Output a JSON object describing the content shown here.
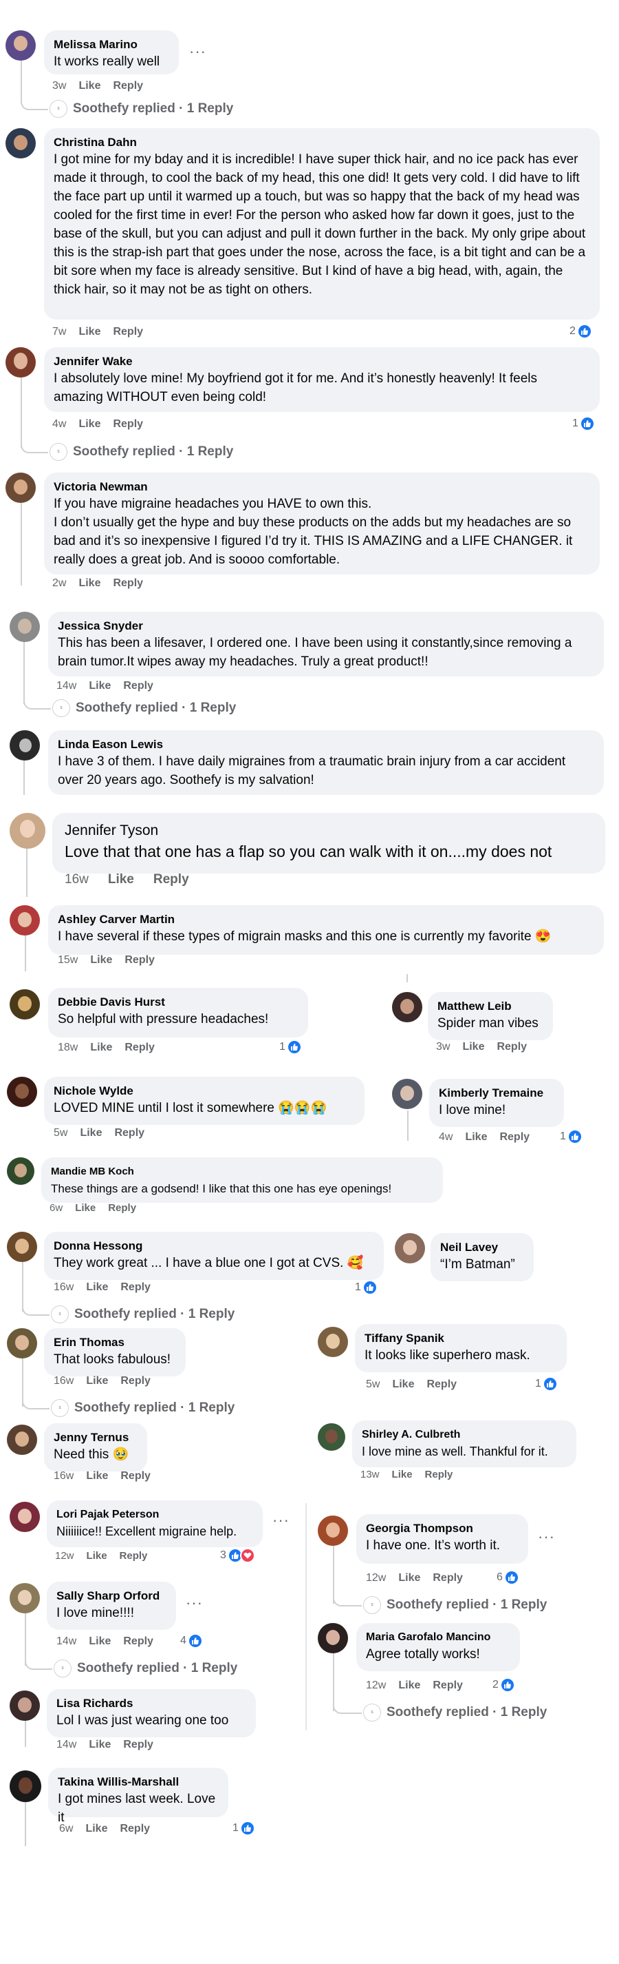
{
  "labels": {
    "like": "Like",
    "reply": "Reply",
    "soothefy_replied": "Soothefy replied · 1 Reply",
    "more": "···"
  },
  "colors": {
    "bubble": "#f0f2f5",
    "meta": "#65676b",
    "like_blue": "#1877f2",
    "heart_red": "#f33e58"
  },
  "comments": [
    {
      "name": "Melissa Marino",
      "text": "It works really well",
      "time": "3w"
    },
    {
      "name": "Christina Dahn",
      "text": "I got mine for my bday and it is incredible! I have super thick hair, and no ice pack has ever made it through, to cool the back of my head, this one did! It gets very cold. I did have to lift the face part up until it warmed up a touch, but was so happy that the back of my head was cooled for the first time in ever! For the person who asked how far down it goes, just to the base of the skull, but you can adjust and pull it down further in the back. My only gripe about this is the strap-ish part that goes under the nose, across the face, is a bit tight and can be a bit sore when my face is already sensitive. But I kind of have a big head, with, again, the thick hair, so it may not be as tight on others.",
      "time": "7w",
      "reactions": "2"
    },
    {
      "name": "Jennifer Wake",
      "text": "I absolutely love mine! My boyfriend got it for me. And it’s honestly heavenly! It feels amazing WITHOUT even being cold!",
      "time": "4w",
      "reactions": "1"
    },
    {
      "name": "Victoria Newman",
      "text": "If you have migraine headaches you HAVE to own this.\nI don’t usually get the hype and buy these products on the adds but my headaches are so bad and it’s so inexpensive I figured I’d try it. THIS IS AMAZING and a LIFE CHANGER. it really does a great job. And is soooo comfortable.",
      "time": "2w"
    },
    {
      "name": "Jessica Snyder",
      "text": "This has been a lifesaver, I ordered one. I have been using it constantly,since removing a brain tumor.It wipes away my headaches. Truly a great product!!",
      "time": "14w"
    },
    {
      "name": "Linda Eason Lewis",
      "text": "I have 3 of them. I have daily migraines from a traumatic brain injury from a car accident over 20 years ago. Soothefy is my salvation!"
    },
    {
      "name": "Jennifer Tyson",
      "text": "Love that that one has a flap so you can walk with it on....my does not",
      "time": "16w"
    },
    {
      "name": "Ashley Carver Martin",
      "text": "I have several if these types of migrain masks and this one is currently my favorite 😍",
      "time": "15w"
    },
    {
      "name": "Debbie Davis Hurst",
      "text": "So helpful with pressure headaches!",
      "time": "18w",
      "reactions": "1"
    },
    {
      "name": "Matthew Leib",
      "text": "Spider man vibes",
      "time": "3w"
    },
    {
      "name": "Nichole Wylde",
      "text": "LOVED MINE until I lost it somewhere 😭😭😭",
      "time": "5w"
    },
    {
      "name": "Kimberly Tremaine",
      "text": "I love mine!",
      "time": "4w",
      "reactions": "1"
    },
    {
      "name": "Mandie MB Koch",
      "text": "These things are a godsend! I like that this one has eye openings!",
      "time": "6w"
    },
    {
      "name": "Donna Hessong",
      "text": "They work great ... I have a blue one I got at CVS. 🥰",
      "time": "16w",
      "reactions": "1"
    },
    {
      "name": "Neil Lavey",
      "text": "“I’m Batman”"
    },
    {
      "name": "Erin Thomas",
      "text": "That looks fabulous!",
      "time": "16w"
    },
    {
      "name": "Tiffany Spanik",
      "text": "It looks like superhero mask.",
      "time": "5w",
      "reactions": "1"
    },
    {
      "name": "Jenny Ternus",
      "text": "Need this 🥹",
      "time": "16w"
    },
    {
      "name": "Shirley A. Culbreth",
      "text": "I love mine as well. Thankful for it.",
      "time": "13w"
    },
    {
      "name": "Lori Pajak Peterson",
      "text": "Niiiiiice!! Excellent migraine help.",
      "time": "12w",
      "reactions": "3"
    },
    {
      "name": "Georgia Thompson",
      "text": "I have one. It’s worth it.",
      "time": "12w",
      "reactions": "6"
    },
    {
      "name": "Sally Sharp Orford",
      "text": "I love mine!!!!",
      "time": "14w",
      "reactions": "4"
    },
    {
      "name": "Maria Garofalo Mancino",
      "text": "Agree totally works!",
      "time": "12w",
      "reactions": "2"
    },
    {
      "name": "Lisa Richards",
      "text": "Lol I was just wearing one too",
      "time": "14w"
    },
    {
      "name": "Takina Willis-Marshall",
      "text": "I got mines last week. Love it",
      "time": "6w",
      "reactions": "1"
    }
  ]
}
